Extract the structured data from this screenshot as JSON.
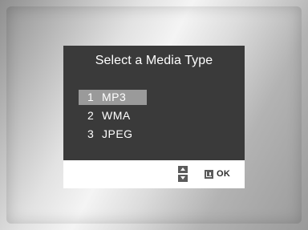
{
  "dialog": {
    "title": "Select a Media Type",
    "items": [
      {
        "number": "1",
        "label": "MP3",
        "selected": true
      },
      {
        "number": "2",
        "label": "WMA",
        "selected": false
      },
      {
        "number": "3",
        "label": "JPEG",
        "selected": false
      }
    ],
    "footer": {
      "nav_icon": "up-down-arrows-icon",
      "enter_icon": "enter-icon",
      "ok_label": "OK"
    }
  },
  "colors": {
    "dialog_background": "#3a3a3a",
    "selected_highlight": "#9a9a9a",
    "footer_background": "#ffffff",
    "text": "#ffffff"
  }
}
